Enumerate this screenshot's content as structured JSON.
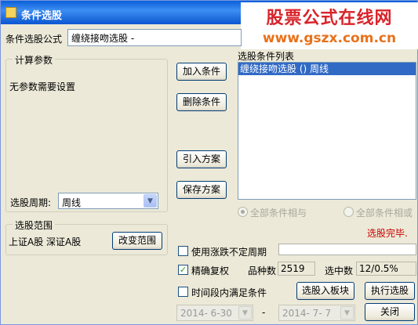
{
  "window": {
    "title": "条件选股",
    "watermark_line1": "股票公式在线网",
    "watermark_line2": "www.gszx.com.cn"
  },
  "formula": {
    "label": "条件选股公式",
    "value": "缠绕接吻选股 -"
  },
  "params": {
    "group_title": "计算参数",
    "text": "无参数需要设置"
  },
  "period": {
    "label": "选股周期:",
    "value": "周线"
  },
  "buttons": {
    "add": "加入条件",
    "delete": "删除条件",
    "import": "引入方案",
    "save": "保存方案",
    "change_range": "改变范围",
    "to_block": "选股入板块",
    "execute": "执行选股",
    "close": "关闭"
  },
  "conditions": {
    "label": "选股条件列表",
    "items": [
      "缠绕接吻选股  () 周线"
    ]
  },
  "logic": {
    "all_and": "全部条件相与",
    "all_or": "全部条件相或"
  },
  "status": {
    "text": "选股完毕.",
    "color": "#cc0000"
  },
  "range": {
    "group_title": "选股范围",
    "value": "上证A股 深证A股"
  },
  "options": {
    "use_variable_period": "使用涨跌不定周期",
    "precise_rights": "精确复权",
    "time_period": "时间段内满足条件"
  },
  "stats": {
    "count_label": "品种数",
    "count_value": "2519",
    "selected_label": "选中数",
    "selected_value": "12/0.5%"
  },
  "dates": {
    "start": "2014- 6-30",
    "separator": "-",
    "end": "2014- 7- 7"
  }
}
